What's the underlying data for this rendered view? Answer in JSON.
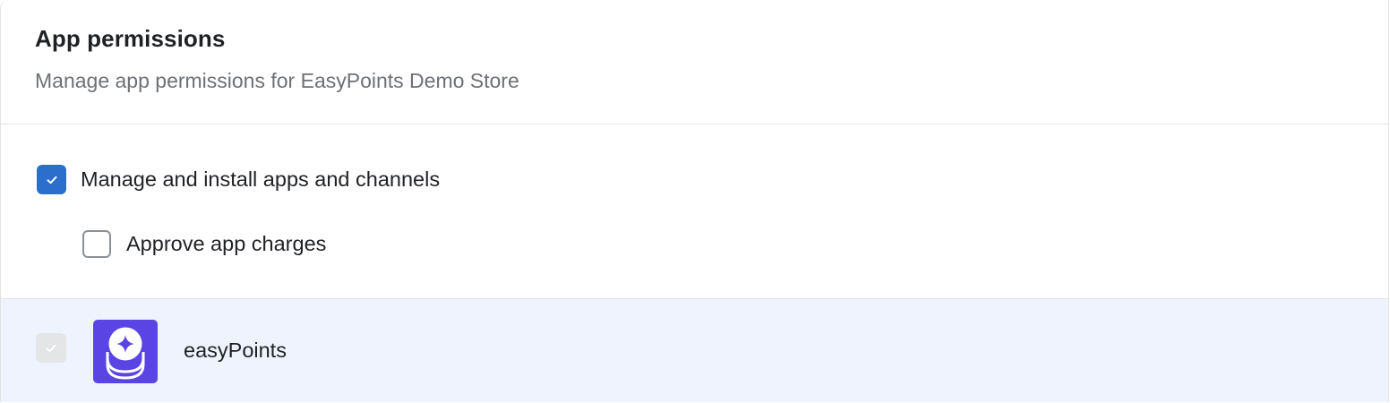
{
  "panel": {
    "title": "App permissions",
    "subtitle": "Manage app permissions for EasyPoints Demo Store"
  },
  "permissions": [
    {
      "label": "Manage and install apps and channels",
      "checked": true
    },
    {
      "label": "Approve app charges",
      "checked": false
    }
  ],
  "apps": [
    {
      "name": "easyPoints",
      "checked": true,
      "disabled": true,
      "icon": "easypoints-logo-icon"
    }
  ],
  "colors": {
    "accent": "#2c6ecb",
    "app_row_bg": "#eff3fd",
    "app_logo_bg": "#5a44e4",
    "subtitle": "#6d7175"
  },
  "icons": {
    "check": "checkmark-icon",
    "app_logo": "easypoints-logo-icon"
  }
}
